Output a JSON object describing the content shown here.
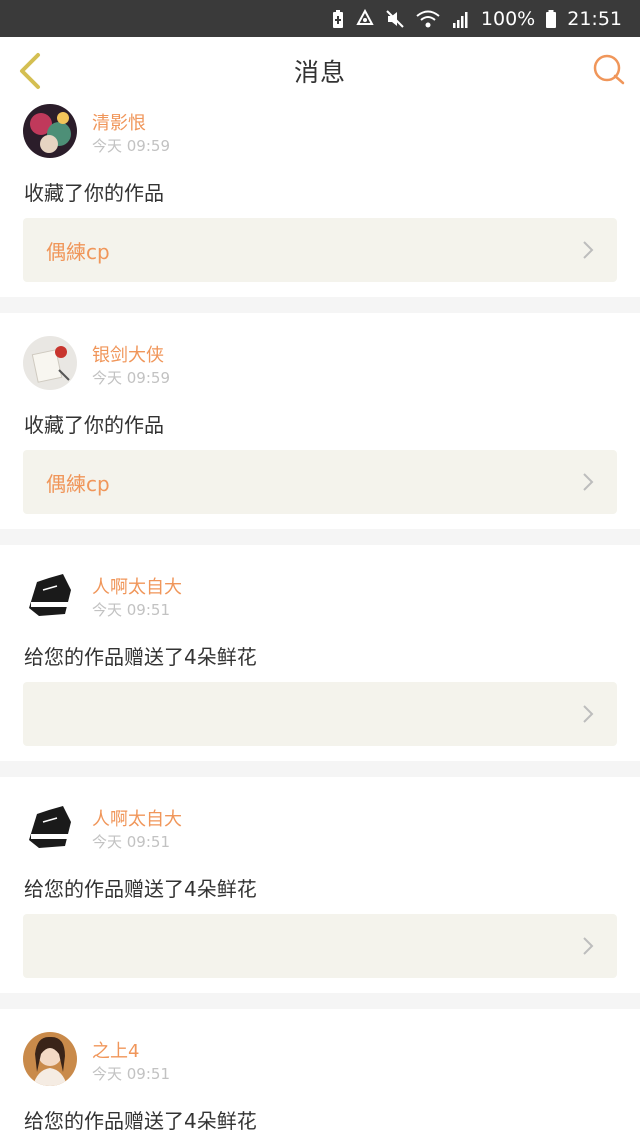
{
  "status_bar": {
    "battery": "100%",
    "time": "21:51",
    "icons": [
      "battery-saver-icon",
      "recycle-icon",
      "mute-icon",
      "wifi-icon",
      "signal-icon",
      "battery-icon"
    ]
  },
  "nav": {
    "title": "消息",
    "back_icon": "chevron-left-icon",
    "search_icon": "search-icon"
  },
  "colors": {
    "accent": "#f0965a",
    "back_arrow": "#d4bf52",
    "card_bg": "#ffffff",
    "work_box_bg": "#f4f3ec",
    "page_bg": "#f5f5f5"
  },
  "notifications": [
    {
      "username": "清影恨",
      "time": "今天 09:59",
      "message": "收藏了你的作品",
      "work_title": "偶練cp",
      "avatar": "avatar-anime"
    },
    {
      "username": "银剑大侠",
      "time": "今天 09:59",
      "message": "收藏了你的作品",
      "work_title": "偶練cp",
      "avatar": "avatar-desk"
    },
    {
      "username": "人啊太自大",
      "time": "今天 09:51",
      "message": "给您的作品赠送了4朵鲜花",
      "work_title": "",
      "avatar": "avatar-sketch"
    },
    {
      "username": "人啊太自大",
      "time": "今天 09:51",
      "message": "给您的作品赠送了4朵鲜花",
      "work_title": "",
      "avatar": "avatar-sketch"
    },
    {
      "username": "之上4",
      "time": "今天 09:51",
      "message": "给您的作品赠送了4朵鲜花",
      "work_title": "",
      "avatar": "avatar-girl"
    }
  ]
}
